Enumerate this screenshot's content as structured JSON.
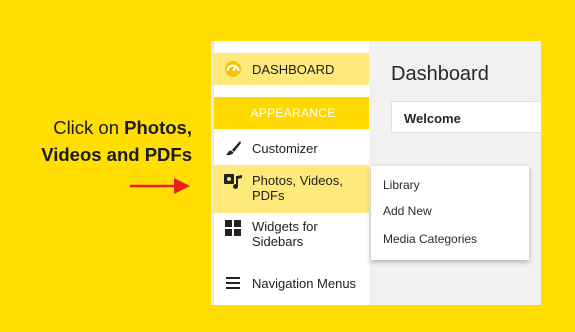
{
  "instruction": {
    "prefix": "Click on ",
    "bold": "Photos, Videos and PDFs"
  },
  "sidebar": {
    "dashboard": "DASHBOARD",
    "appearance": "APPEARANCE",
    "items": [
      {
        "label": "Customizer",
        "icon": "brush-icon"
      },
      {
        "label": "Photos, Videos, PDFs",
        "icon": "media-icon"
      },
      {
        "label": "Widgets for Sidebars",
        "icon": "widgets-icon"
      },
      {
        "label": "Navigation Menus",
        "icon": "menu-icon"
      }
    ]
  },
  "main": {
    "title": "Dashboard",
    "welcome": "Welcome"
  },
  "flyout": {
    "items": [
      "Library",
      "Add New",
      "Media Categories"
    ]
  },
  "colors": {
    "background": "#ffde00",
    "highlight": "#ffe97a",
    "appearance_bar": "#ffd800",
    "arrow": "#e8201b"
  }
}
